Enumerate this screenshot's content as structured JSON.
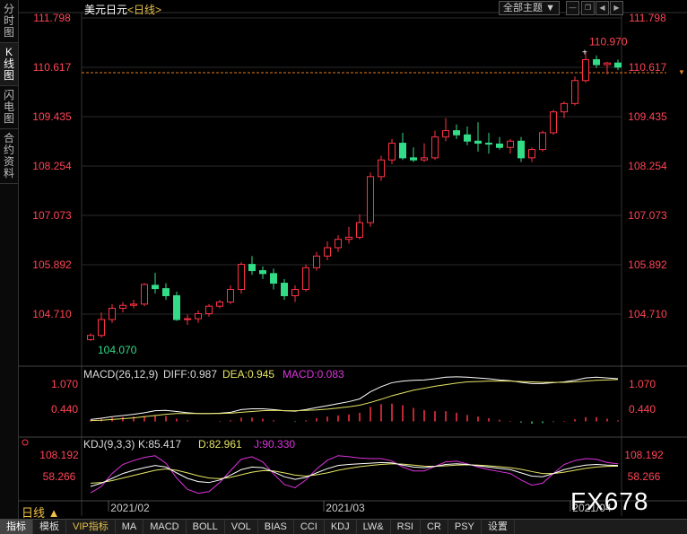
{
  "symbol_title": "美元日元",
  "period_title": "<日线>",
  "theme_label": "全部主题",
  "side_tabs": [
    {
      "label": "分时图",
      "active": false
    },
    {
      "label": "K线图",
      "active": true
    },
    {
      "label": "闪电图",
      "active": false
    },
    {
      "label": "合约资料",
      "active": false
    }
  ],
  "bottom_tabs": [
    {
      "label": "指标",
      "active": true,
      "vip": false
    },
    {
      "label": "模板",
      "active": false,
      "vip": false
    },
    {
      "label": "VIP指标",
      "active": false,
      "vip": true
    },
    {
      "label": "MA",
      "active": false,
      "vip": false
    },
    {
      "label": "MACD",
      "active": false,
      "vip": false
    },
    {
      "label": "BOLL",
      "active": false,
      "vip": false
    },
    {
      "label": "VOL",
      "active": false,
      "vip": false
    },
    {
      "label": "BIAS",
      "active": false,
      "vip": false
    },
    {
      "label": "CCI",
      "active": false,
      "vip": false
    },
    {
      "label": "KDJ",
      "active": false,
      "vip": false
    },
    {
      "label": "LW&",
      "active": false,
      "vip": false
    },
    {
      "label": "RSI",
      "active": false,
      "vip": false
    },
    {
      "label": "CR",
      "active": false,
      "vip": false
    },
    {
      "label": "PSY",
      "active": false,
      "vip": false
    },
    {
      "label": "设置",
      "active": false,
      "vip": false
    }
  ],
  "period_tag": "日线 ▲",
  "watermark": "FX678",
  "colors": {
    "up": "#ff3344",
    "down": "#33dd88",
    "grid": "#2a2a2a",
    "axis_text": "#ff4455",
    "dif": "#ffffff",
    "dea": "#e6e666",
    "macd": "#dd33dd",
    "k": "#ffffff",
    "d": "#e6e666",
    "j": "#dd33dd"
  },
  "chart_data": {
    "type": "candlestick",
    "y_ticks": [
      "111.798",
      "110.617",
      "109.435",
      "108.254",
      "107.073",
      "105.892",
      "104.710"
    ],
    "ylim": [
      104.3,
      112.0
    ],
    "last_price": "110.617",
    "high_label": "110.970",
    "low_label": "104.070",
    "x_labels": [
      "2021/02",
      "2021/03",
      "2021/04"
    ],
    "candles": [
      {
        "o": 104.1,
        "h": 104.25,
        "l": 104.07,
        "c": 104.2
      },
      {
        "o": 104.2,
        "h": 104.75,
        "l": 104.15,
        "c": 104.58
      },
      {
        "o": 104.58,
        "h": 104.95,
        "l": 104.5,
        "c": 104.85
      },
      {
        "o": 104.85,
        "h": 105.0,
        "l": 104.75,
        "c": 104.92
      },
      {
        "o": 104.92,
        "h": 105.05,
        "l": 104.85,
        "c": 104.95
      },
      {
        "o": 104.95,
        "h": 105.45,
        "l": 104.9,
        "c": 105.42
      },
      {
        "o": 105.4,
        "h": 105.7,
        "l": 105.2,
        "c": 105.32
      },
      {
        "o": 105.32,
        "h": 105.45,
        "l": 105.05,
        "c": 105.15
      },
      {
        "o": 105.15,
        "h": 105.25,
        "l": 104.55,
        "c": 104.58
      },
      {
        "o": 104.58,
        "h": 104.7,
        "l": 104.45,
        "c": 104.6
      },
      {
        "o": 104.6,
        "h": 104.8,
        "l": 104.5,
        "c": 104.72
      },
      {
        "o": 104.72,
        "h": 104.95,
        "l": 104.65,
        "c": 104.9
      },
      {
        "o": 104.9,
        "h": 105.05,
        "l": 104.85,
        "c": 105.0
      },
      {
        "o": 105.0,
        "h": 105.4,
        "l": 104.95,
        "c": 105.3
      },
      {
        "o": 105.3,
        "h": 105.95,
        "l": 105.2,
        "c": 105.9
      },
      {
        "o": 105.9,
        "h": 106.1,
        "l": 105.65,
        "c": 105.75
      },
      {
        "o": 105.75,
        "h": 105.85,
        "l": 105.55,
        "c": 105.68
      },
      {
        "o": 105.68,
        "h": 105.8,
        "l": 105.3,
        "c": 105.45
      },
      {
        "o": 105.45,
        "h": 105.55,
        "l": 105.05,
        "c": 105.15
      },
      {
        "o": 105.15,
        "h": 105.4,
        "l": 105.0,
        "c": 105.3
      },
      {
        "o": 105.3,
        "h": 105.9,
        "l": 105.25,
        "c": 105.82
      },
      {
        "o": 105.82,
        "h": 106.2,
        "l": 105.75,
        "c": 106.1
      },
      {
        "o": 106.1,
        "h": 106.45,
        "l": 106.0,
        "c": 106.3
      },
      {
        "o": 106.3,
        "h": 106.6,
        "l": 106.2,
        "c": 106.5
      },
      {
        "o": 106.5,
        "h": 106.8,
        "l": 106.4,
        "c": 106.55
      },
      {
        "o": 106.55,
        "h": 107.1,
        "l": 106.5,
        "c": 106.9
      },
      {
        "o": 106.9,
        "h": 108.1,
        "l": 106.8,
        "c": 108.0
      },
      {
        "o": 108.0,
        "h": 108.5,
        "l": 107.9,
        "c": 108.4
      },
      {
        "o": 108.4,
        "h": 108.9,
        "l": 108.3,
        "c": 108.8
      },
      {
        "o": 108.8,
        "h": 109.05,
        "l": 108.4,
        "c": 108.45
      },
      {
        "o": 108.45,
        "h": 108.7,
        "l": 108.35,
        "c": 108.4
      },
      {
        "o": 108.4,
        "h": 108.8,
        "l": 108.35,
        "c": 108.45
      },
      {
        "o": 108.45,
        "h": 109.1,
        "l": 108.4,
        "c": 108.95
      },
      {
        "o": 108.95,
        "h": 109.4,
        "l": 108.85,
        "c": 109.1
      },
      {
        "o": 109.1,
        "h": 109.25,
        "l": 108.9,
        "c": 109.0
      },
      {
        "o": 109.0,
        "h": 109.2,
        "l": 108.75,
        "c": 108.85
      },
      {
        "o": 108.85,
        "h": 109.3,
        "l": 108.6,
        "c": 108.8
      },
      {
        "o": 108.8,
        "h": 109.05,
        "l": 108.55,
        "c": 108.78
      },
      {
        "o": 108.78,
        "h": 108.95,
        "l": 108.65,
        "c": 108.7
      },
      {
        "o": 108.7,
        "h": 108.9,
        "l": 108.55,
        "c": 108.85
      },
      {
        "o": 108.85,
        "h": 108.95,
        "l": 108.35,
        "c": 108.45
      },
      {
        "o": 108.45,
        "h": 108.7,
        "l": 108.35,
        "c": 108.65
      },
      {
        "o": 108.65,
        "h": 109.1,
        "l": 108.6,
        "c": 109.05
      },
      {
        "o": 109.05,
        "h": 109.6,
        "l": 109.0,
        "c": 109.55
      },
      {
        "o": 109.55,
        "h": 109.8,
        "l": 109.4,
        "c": 109.75
      },
      {
        "o": 109.75,
        "h": 110.4,
        "l": 109.7,
        "c": 110.3
      },
      {
        "o": 110.3,
        "h": 110.97,
        "l": 110.25,
        "c": 110.8
      },
      {
        "o": 110.8,
        "h": 110.9,
        "l": 110.6,
        "c": 110.68
      },
      {
        "o": 110.68,
        "h": 110.75,
        "l": 110.45,
        "c": 110.72
      },
      {
        "o": 110.72,
        "h": 110.8,
        "l": 110.55,
        "c": 110.62
      }
    ],
    "macd": {
      "title": "MACD(26,12,9)",
      "diff_label": "DIFF:0.987",
      "dea_label": "DEA:0.945",
      "macd_label": "MACD:0.083",
      "y_ticks": [
        "1.070",
        "0.440"
      ],
      "ylim": [
        -0.05,
        1.2
      ],
      "dif": [
        0.05,
        0.08,
        0.12,
        0.15,
        0.18,
        0.22,
        0.27,
        0.28,
        0.25,
        0.22,
        0.2,
        0.2,
        0.21,
        0.23,
        0.3,
        0.32,
        0.32,
        0.3,
        0.27,
        0.26,
        0.3,
        0.35,
        0.4,
        0.45,
        0.5,
        0.57,
        0.75,
        0.88,
        0.98,
        1.02,
        1.04,
        1.05,
        1.08,
        1.12,
        1.13,
        1.12,
        1.1,
        1.08,
        1.05,
        1.03,
        0.99,
        0.96,
        0.96,
        0.98,
        1.0,
        1.04,
        1.1,
        1.12,
        1.1,
        1.08
      ],
      "dea": [
        0.02,
        0.03,
        0.05,
        0.07,
        0.09,
        0.12,
        0.15,
        0.18,
        0.2,
        0.2,
        0.2,
        0.2,
        0.2,
        0.21,
        0.23,
        0.25,
        0.27,
        0.28,
        0.27,
        0.27,
        0.28,
        0.29,
        0.31,
        0.34,
        0.37,
        0.41,
        0.48,
        0.56,
        0.65,
        0.72,
        0.79,
        0.84,
        0.89,
        0.93,
        0.97,
        1.0,
        1.01,
        1.02,
        1.02,
        1.02,
        1.01,
        1.0,
        0.99,
        0.99,
        0.99,
        1.0,
        1.02,
        1.04,
        1.05,
        1.06
      ],
      "hist": [
        0.06,
        0.1,
        0.14,
        0.16,
        0.18,
        0.2,
        0.24,
        0.2,
        0.1,
        0.04,
        0.0,
        0.0,
        0.02,
        0.04,
        0.14,
        0.14,
        0.1,
        0.04,
        0.0,
        -0.02,
        0.04,
        0.12,
        0.18,
        0.22,
        0.26,
        0.32,
        0.54,
        0.64,
        0.66,
        0.6,
        0.5,
        0.42,
        0.38,
        0.38,
        0.32,
        0.24,
        0.18,
        0.12,
        0.06,
        0.02,
        -0.04,
        -0.08,
        -0.06,
        -0.02,
        0.02,
        0.08,
        0.16,
        0.16,
        0.1,
        0.04
      ]
    },
    "kdj": {
      "title": "KDJ(9,3,3)",
      "k_label": "K:85.417",
      "d_label": "D:82.961",
      "j_label": "J:90.330",
      "y_ticks": [
        "108.192",
        "58.266"
      ],
      "ylim": [
        -10,
        130
      ],
      "k": [
        20,
        30,
        45,
        60,
        70,
        78,
        85,
        80,
        62,
        45,
        35,
        32,
        40,
        55,
        72,
        80,
        78,
        65,
        50,
        42,
        48,
        62,
        75,
        85,
        88,
        90,
        92,
        94,
        93,
        86,
        80,
        78,
        82,
        88,
        90,
        88,
        84,
        80,
        76,
        72,
        62,
        52,
        50,
        60,
        72,
        80,
        86,
        88,
        86,
        85
      ],
      "d": [
        30,
        32,
        38,
        46,
        54,
        62,
        70,
        74,
        70,
        62,
        53,
        46,
        44,
        48,
        56,
        64,
        69,
        68,
        62,
        55,
        52,
        56,
        62,
        70,
        76,
        81,
        85,
        88,
        90,
        89,
        86,
        83,
        82,
        84,
        86,
        87,
        86,
        84,
        81,
        78,
        73,
        66,
        60,
        60,
        64,
        70,
        76,
        80,
        82,
        83
      ],
      "j": [
        0,
        20,
        60,
        88,
        100,
        110,
        115,
        92,
        46,
        11,
        -1,
        4,
        32,
        69,
        104,
        112,
        96,
        59,
        26,
        16,
        40,
        74,
        101,
        115,
        112,
        108,
        106,
        106,
        99,
        80,
        68,
        68,
        82,
        96,
        98,
        90,
        80,
        72,
        66,
        60,
        40,
        24,
        30,
        60,
        88,
        100,
        106,
        104,
        94,
        90
      ]
    }
  }
}
